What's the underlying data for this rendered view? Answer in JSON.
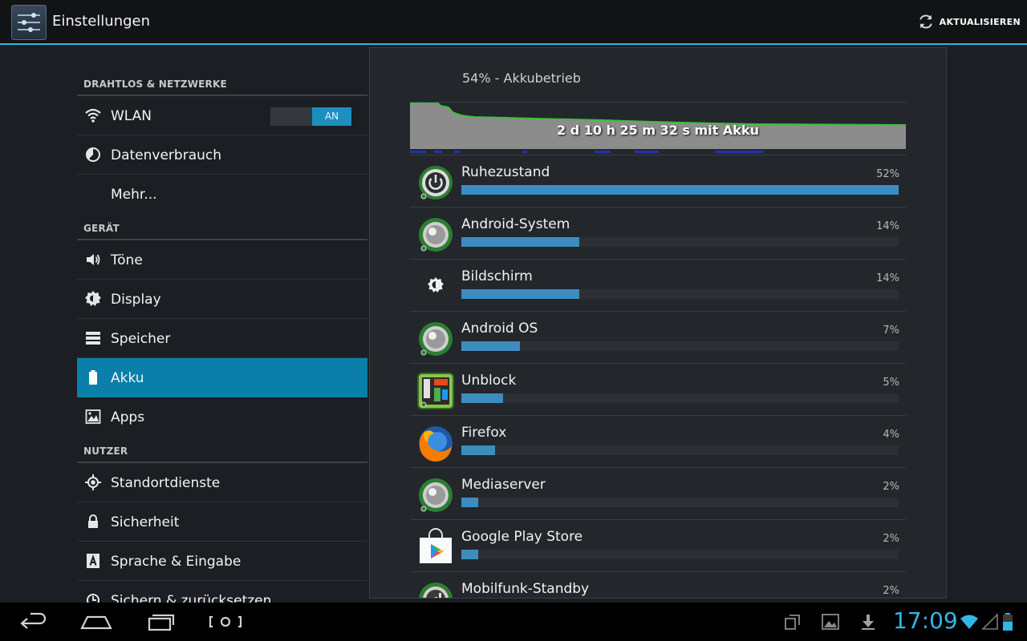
{
  "actionbar": {
    "title": "Einstellungen",
    "refresh_label": "AKTUALISIEREN"
  },
  "sidebar": {
    "sections": [
      {
        "header": "DRAHTLOS & NETZWERKE"
      },
      {
        "header": "GERÄT"
      },
      {
        "header": "NUTZER"
      }
    ],
    "items": [
      {
        "label": "WLAN",
        "icon": "wifi-icon"
      },
      {
        "label": "Datenverbrauch",
        "icon": "data-usage-icon"
      },
      {
        "label": "Mehr...",
        "icon": ""
      },
      {
        "label": "Töne",
        "icon": "speaker-icon"
      },
      {
        "label": "Display",
        "icon": "brightness-icon"
      },
      {
        "label": "Speicher",
        "icon": "storage-icon"
      },
      {
        "label": "Akku",
        "icon": "battery-icon"
      },
      {
        "label": "Apps",
        "icon": "apps-icon"
      },
      {
        "label": "Standortdienste",
        "icon": "location-icon"
      },
      {
        "label": "Sicherheit",
        "icon": "lock-icon"
      },
      {
        "label": "Sprache & Eingabe",
        "icon": "keyboard-icon"
      },
      {
        "label": "Sichern & zurücksetzen",
        "icon": "backup-icon"
      }
    ],
    "wlan_toggle": "AN",
    "selected": "Akku"
  },
  "battery": {
    "status": "54% - Akkubetrieb",
    "graph_label": "2 d 10 h 25 m 32 s mit Akku",
    "entries": [
      {
        "name": "Ruhezustand",
        "percent_label": "52%",
        "percent": 52,
        "icon": "power-icon"
      },
      {
        "name": "Android-System",
        "percent_label": "14%",
        "percent": 14,
        "icon": "android-system-icon"
      },
      {
        "name": "Bildschirm",
        "percent_label": "14%",
        "percent": 14,
        "icon": "screen-brightness-icon"
      },
      {
        "name": "Android OS",
        "percent_label": "7%",
        "percent": 7,
        "icon": "android-os-icon"
      },
      {
        "name": "Unblock",
        "percent_label": "5%",
        "percent": 5,
        "icon": "unblock-app-icon"
      },
      {
        "name": "Firefox",
        "percent_label": "4%",
        "percent": 4,
        "icon": "firefox-icon"
      },
      {
        "name": "Mediaserver",
        "percent_label": "2%",
        "percent": 2,
        "icon": "mediaserver-icon"
      },
      {
        "name": "Google Play Store",
        "percent_label": "2%",
        "percent": 2,
        "icon": "play-store-icon"
      },
      {
        "name": "Mobilfunk-Standby",
        "percent_label": "2%",
        "percent": 2,
        "icon": "cell-standby-icon"
      }
    ]
  },
  "statusbar": {
    "time": "17:09"
  },
  "colors": {
    "accent": "#33b5e5",
    "selected_item": "#0a7fa9",
    "usage_bar": "#3b8dc0",
    "graph_line": "#3fbf3f"
  }
}
